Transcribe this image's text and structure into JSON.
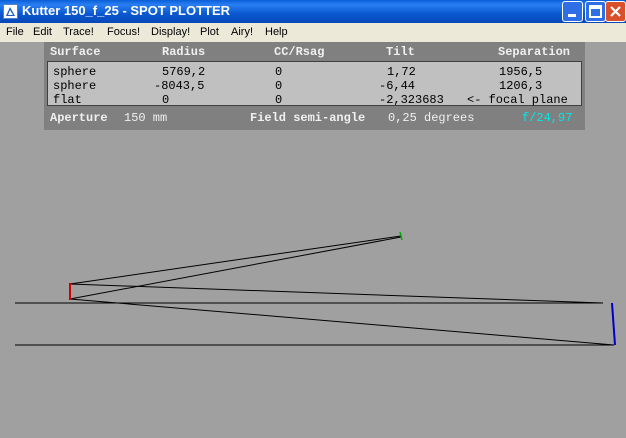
{
  "window": {
    "title": "Kutter 150_f_25 - SPOT PLOTTER",
    "icon": "app-icon",
    "buttons": [
      "minimize-icon",
      "maximize-icon",
      "close-icon"
    ]
  },
  "menu": {
    "file": "File",
    "edit": "Edit",
    "trace": "Trace!",
    "focus": "Focus!",
    "display": "Display!",
    "plot": "Plot",
    "airy": "Airy!",
    "help": "Help"
  },
  "table": {
    "headers": {
      "surface": "Surface",
      "radius": "Radius",
      "cc": "CC/Rsag",
      "tilt": "Tilt",
      "separation": "Separation"
    },
    "rows": [
      {
        "surface": "sphere",
        "radius": "5769,2",
        "cc": "0",
        "tilt": "1,72",
        "separation": "1956,5"
      },
      {
        "surface": "sphere",
        "radius": "-8043,5",
        "cc": "0",
        "tilt": "-6,44",
        "separation": "1206,3"
      },
      {
        "surface": "flat",
        "radius": "0",
        "cc": "0",
        "tilt": "-2,323683",
        "separation": "<- focal plane"
      }
    ]
  },
  "footer": {
    "aperture_label": "Aperture",
    "aperture_value": "150 mm",
    "field_label": "Field semi-angle",
    "field_value": "0,25 degrees",
    "f_ratio": "f/24,97"
  },
  "colors": {
    "background": "#a0a0a0",
    "panel": "#808080",
    "table": "#c0c0c0",
    "f_ratio": "#00e8e8",
    "primary_mirror": "#0000cc",
    "secondary_mirror": "#cc0000",
    "focal_plane": "#00aa00"
  }
}
